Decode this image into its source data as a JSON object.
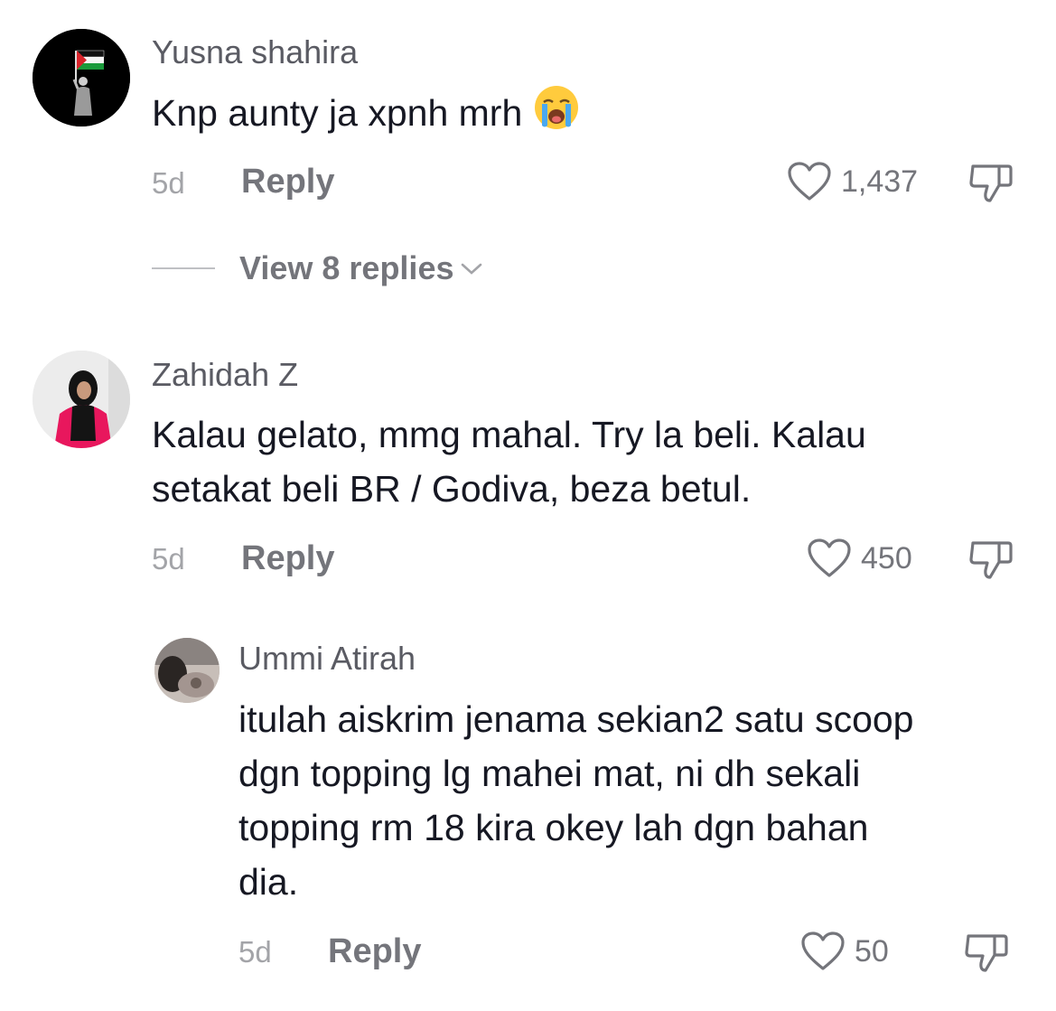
{
  "comments": [
    {
      "username": "Yusna shahira",
      "text": "Knp aunty ja xpnh mrh",
      "emoji": "loudly-crying-face",
      "age": "5d",
      "reply_label": "Reply",
      "likes": "1,437",
      "view_replies": "View 8 replies"
    },
    {
      "username": "Zahidah Z",
      "text_lines": [
        "Kalau gelato, mmg mahal. Try la beli. Kalau",
        "setakat beli BR / Godiva, beza betul."
      ],
      "age": "5d",
      "reply_label": "Reply",
      "likes": "450"
    },
    {
      "username": "Ummi Atirah",
      "text_lines": [
        "itulah aiskrim jenama sekian2 satu scoop",
        "dgn topping lg mahei mat, ni dh sekali",
        "topping rm 18 kira okey lah dgn bahan",
        "dia."
      ],
      "age": "5d",
      "reply_label": "Reply",
      "likes": "50"
    }
  ],
  "icons": {
    "like": "heart-outline-icon",
    "dislike": "thumbs-down-icon",
    "expand": "chevron-down-icon"
  },
  "colors": {
    "text": "#161823",
    "username": "#5a5b63",
    "muted": "#a3a4a8",
    "action": "#74757b"
  }
}
